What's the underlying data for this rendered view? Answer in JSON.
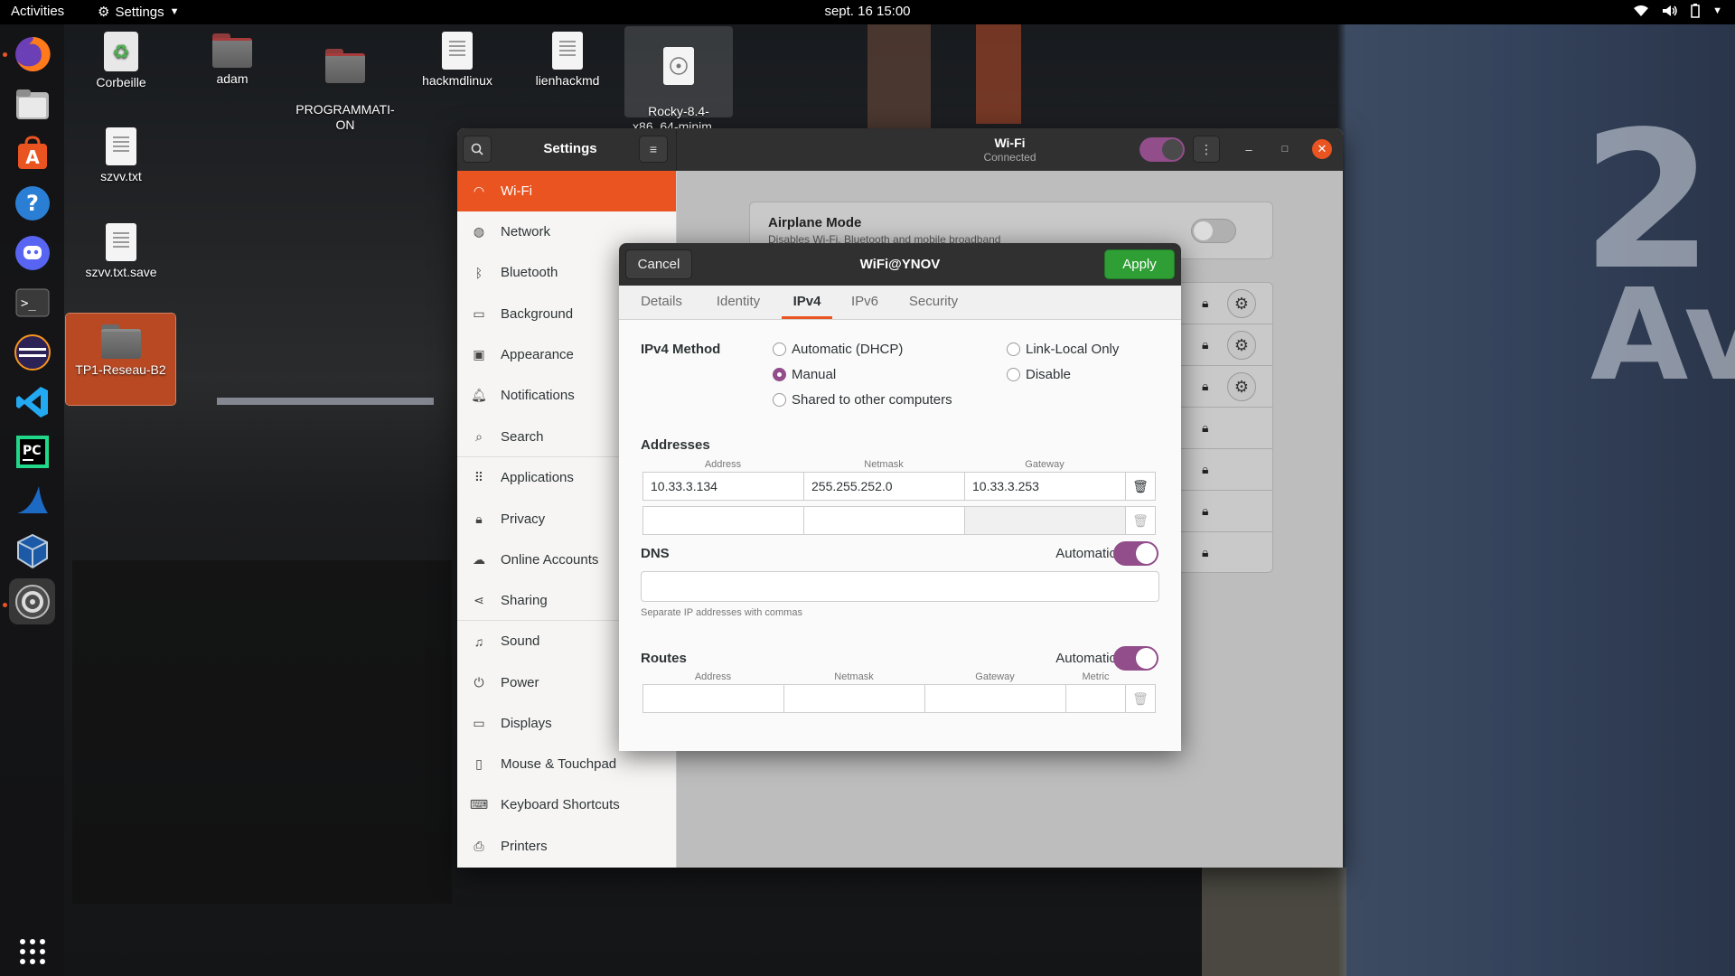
{
  "topbar": {
    "activities": "Activities",
    "app_menu": "Settings",
    "clock": "sept. 16  15:00"
  },
  "desktop": {
    "icons": [
      {
        "label": "Corbeille"
      },
      {
        "label": "adam"
      },
      {
        "label": "PROGRAMMATI-\nON"
      },
      {
        "label": "hackmdlinux"
      },
      {
        "label": "lienhackmd"
      },
      {
        "label": "Rocky-8.4-\nx86_64-minim…"
      },
      {
        "label": "szvv.txt"
      },
      {
        "label": "szvv.txt.save"
      },
      {
        "label": "TP1-Reseau-B2"
      }
    ]
  },
  "settings": {
    "header_title": "Settings",
    "page_title": "Wi-Fi",
    "page_subtitle": "Connected",
    "sidebar": [
      {
        "label": "Wi-Fi",
        "icon": "wifi-icon"
      },
      {
        "label": "Network",
        "icon": "network-icon"
      },
      {
        "label": "Bluetooth",
        "icon": "bluetooth-icon"
      },
      {
        "label": "Background",
        "icon": "background-icon"
      },
      {
        "label": "Appearance",
        "icon": "appearance-icon"
      },
      {
        "label": "Notifications",
        "icon": "bell-icon"
      },
      {
        "label": "Search",
        "icon": "search-icon"
      },
      {
        "label": "Applications",
        "icon": "apps-grid-icon"
      },
      {
        "label": "Privacy",
        "icon": "lock-icon"
      },
      {
        "label": "Online Accounts",
        "icon": "cloud-icon"
      },
      {
        "label": "Sharing",
        "icon": "share-icon"
      },
      {
        "label": "Sound",
        "icon": "music-note-icon"
      },
      {
        "label": "Power",
        "icon": "power-icon"
      },
      {
        "label": "Displays",
        "icon": "display-icon"
      },
      {
        "label": "Mouse & Touchpad",
        "icon": "mouse-icon"
      },
      {
        "label": "Keyboard Shortcuts",
        "icon": "keyboard-icon"
      },
      {
        "label": "Printers",
        "icon": "printer-icon"
      }
    ],
    "airplane_mode": {
      "title": "Airplane Mode",
      "subtitle": "Disables Wi-Fi, Bluetooth and mobile broadband"
    }
  },
  "dialog": {
    "title": "WiFi@YNOV",
    "cancel_label": "Cancel",
    "apply_label": "Apply",
    "tabs": [
      "Details",
      "Identity",
      "IPv4",
      "IPv6",
      "Security"
    ],
    "active_tab": "IPv4",
    "ipv4_method_label": "IPv4 Method",
    "methods": {
      "automatic": "Automatic (DHCP)",
      "link_local": "Link-Local Only",
      "manual": "Manual",
      "disable": "Disable",
      "shared": "Shared to other computers"
    },
    "selected_method": "Manual",
    "addresses_label": "Addresses",
    "address_columns": {
      "address": "Address",
      "netmask": "Netmask",
      "gateway": "Gateway"
    },
    "address_rows": [
      {
        "address": "10.33.3.134",
        "netmask": "255.255.252.0",
        "gateway": "10.33.3.253"
      },
      {
        "address": "",
        "netmask": "",
        "gateway": ""
      }
    ],
    "dns": {
      "label": "DNS",
      "automatic_label": "Automatic",
      "automatic_on": true,
      "value": "",
      "hint": "Separate IP addresses with commas"
    },
    "routes": {
      "label": "Routes",
      "automatic_label": "Automatic",
      "automatic_on": true,
      "columns": {
        "address": "Address",
        "netmask": "Netmask",
        "gateway": "Gateway",
        "metric": "Metric"
      }
    }
  },
  "colors": {
    "accent_orange": "#e95420",
    "toggle_purple": "#924d8b",
    "apply_green": "#2e9e35",
    "header_dark": "#303030"
  }
}
